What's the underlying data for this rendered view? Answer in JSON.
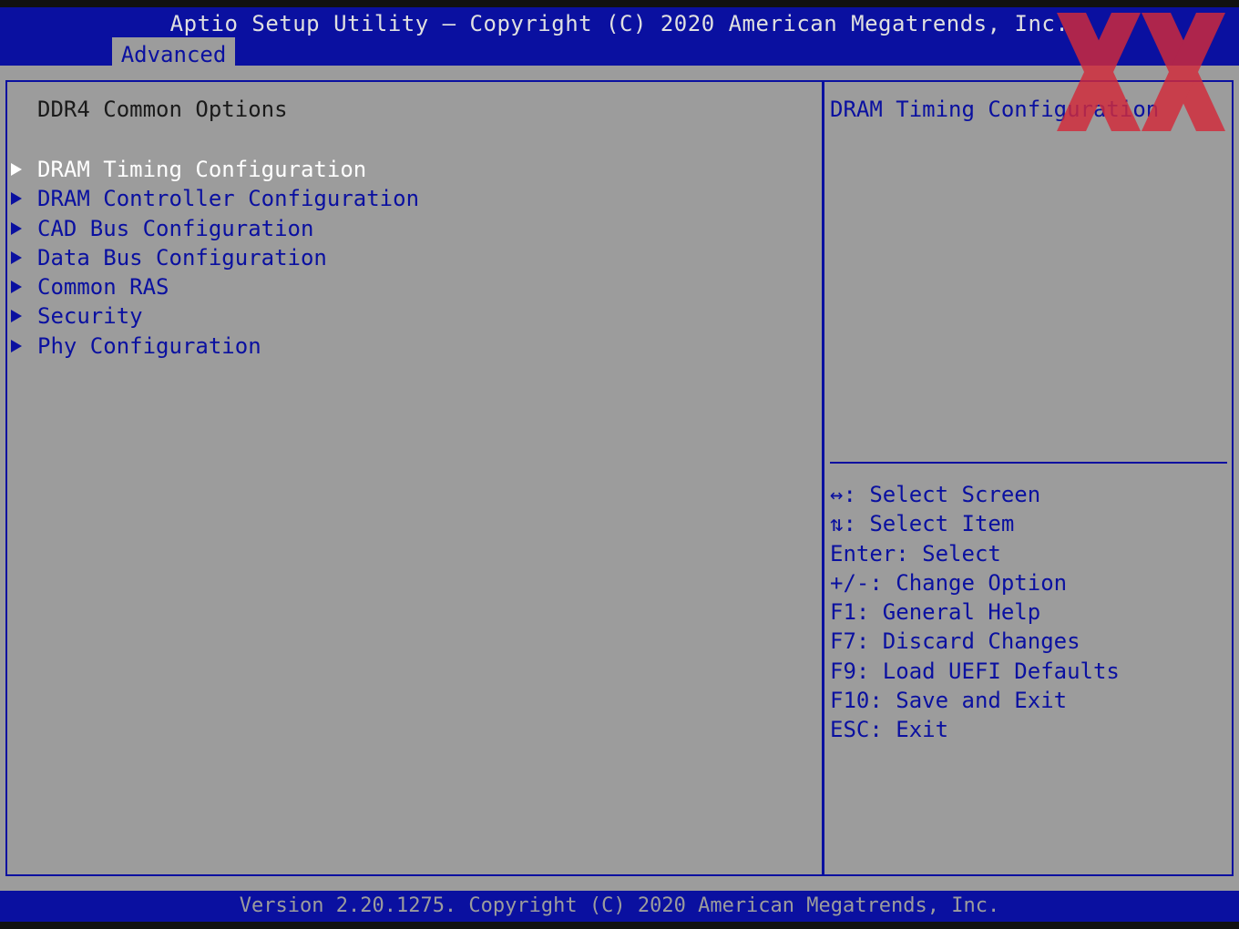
{
  "header": {
    "title": "Aptio Setup Utility – Copyright (C) 2020 American Megatrends, Inc.",
    "active_tab": "Advanced"
  },
  "main": {
    "section_title": "DDR4 Common Options",
    "items": [
      {
        "label": "DRAM Timing Configuration"
      },
      {
        "label": "DRAM Controller Configuration"
      },
      {
        "label": "CAD Bus Configuration"
      },
      {
        "label": "Data Bus Configuration"
      },
      {
        "label": "Common RAS"
      },
      {
        "label": "Security"
      },
      {
        "label": "Phy Configuration"
      }
    ],
    "selected_index": 0
  },
  "help": {
    "text": "DRAM Timing Configuration"
  },
  "keys": [
    "↔: Select Screen",
    "⇅: Select Item",
    "Enter: Select",
    "+/-: Change Option",
    "F1: General Help",
    "F7: Discard Changes",
    "F9: Load UEFI Defaults",
    "F10: Save and Exit",
    "ESC: Exit"
  ],
  "footer": {
    "text": "Version 2.20.1275. Copyright (C) 2020 American Megatrends, Inc."
  },
  "colors": {
    "bios_blue": "#0a10a0",
    "bios_gray": "#9c9c9c",
    "watermark_red": "#d22a3a"
  }
}
